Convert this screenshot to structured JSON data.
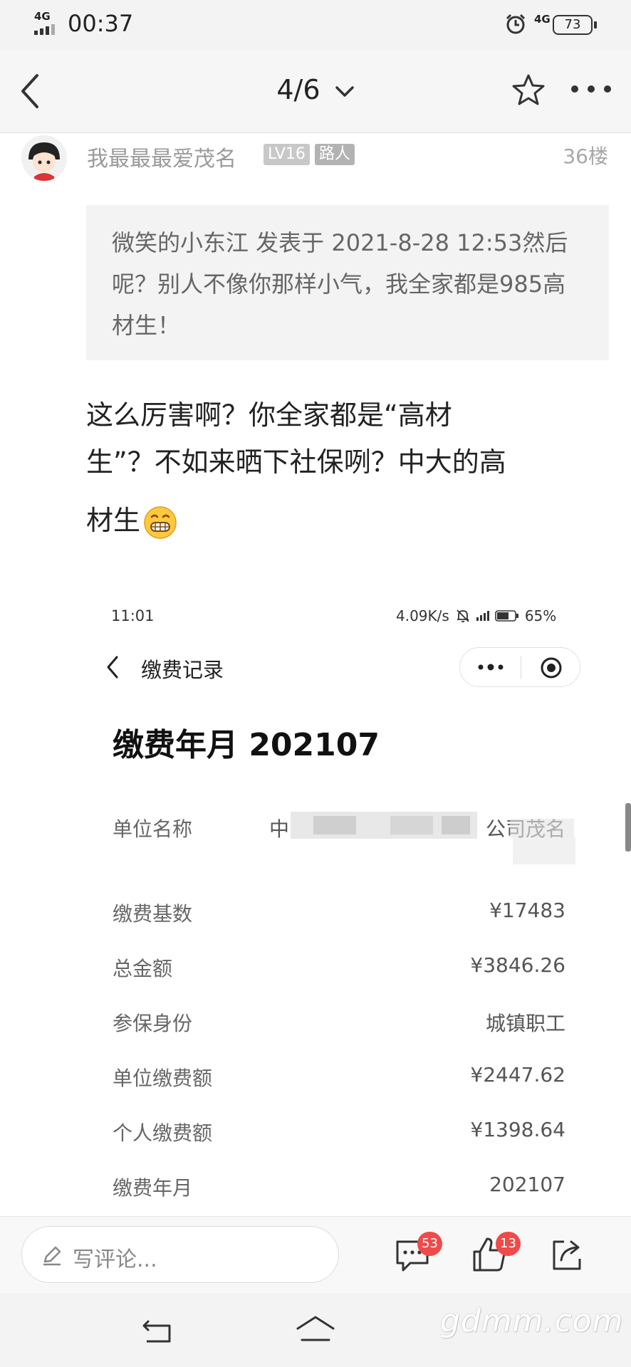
{
  "status_bar": {
    "time": "00:37",
    "network_left": "4G",
    "network_right": "4G",
    "battery": "73"
  },
  "nav": {
    "title": "4/6"
  },
  "post": {
    "username": "我最最最爱茂名",
    "level": "LV16",
    "role": "路人",
    "floor": "36楼",
    "quote": "微笑的小东江 发表于 2021-8-28 12:53然后呢？别人不像你那样小气，我全家都是985高材生！",
    "body_line1": "这么厉害啊？你全家都是“高材",
    "body_line2": "生”？不如来晒下社保咧？中大的高",
    "body_line3": "材生"
  },
  "screenshot": {
    "time": "11:01",
    "speed": "4.09K/s",
    "battery": "65%",
    "page_title": "缴费记录",
    "heading": "缴费年月 202107",
    "rows": [
      {
        "label": "单位名称",
        "value": "中",
        "value_suffix": "公司茂名"
      },
      {
        "label": "缴费基数",
        "value": "¥17483"
      },
      {
        "label": "总金额",
        "value": "¥3846.26"
      },
      {
        "label": "参保身份",
        "value": "城镇职工"
      },
      {
        "label": "单位缴费额",
        "value": "¥2447.62"
      },
      {
        "label": "个人缴费额",
        "value": "¥1398.64"
      },
      {
        "label": "缴费年月",
        "value": "202107"
      }
    ]
  },
  "bottom_bar": {
    "comment_placeholder": "写评论...",
    "comment_count": "53",
    "like_count": "13"
  },
  "watermark": "gdmm.com",
  "colors": {
    "badge_red": "#f04a4a",
    "quote_bg": "#f3f3f3",
    "muted_text": "#9a9a9a"
  }
}
